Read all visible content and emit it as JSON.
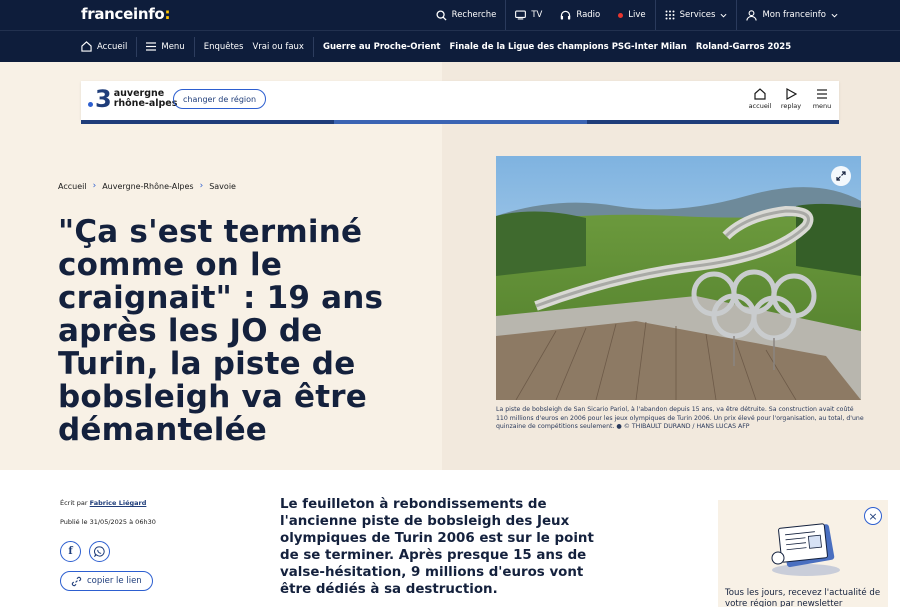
{
  "header": {
    "logo_main": "franceinfo",
    "logo_dot": ":",
    "search_label": "Recherche",
    "tv_label": "TV",
    "radio_label": "Radio",
    "live_label": "Live",
    "services_label": "Services",
    "account_label": "Mon franceinfo"
  },
  "subnav": {
    "home_label": "Accueil",
    "menu_label": "Menu",
    "links": [
      "Enquêtes",
      "Vrai ou faux"
    ],
    "topics": [
      "Guerre au Proche-Orient",
      "Finale de la Ligue des champions PSG-Inter Milan",
      "Roland-Garros 2025"
    ]
  },
  "region": {
    "number": "3",
    "name_line1": "auvergne",
    "name_line2": "rhône-alpes",
    "change_label": "changer de région",
    "nav": [
      {
        "label": "accueil",
        "icon": "home-icon"
      },
      {
        "label": "replay",
        "icon": "play-icon"
      },
      {
        "label": "menu",
        "icon": "hamburger-icon"
      }
    ]
  },
  "breadcrumb": [
    "Accueil",
    "Auvergne-Rhône-Alpes",
    "Savoie"
  ],
  "article": {
    "headline": "\"Ça s'est terminé comme on le craignait\" : 19 ans après les JO de Turin, la piste de bobsleigh va être démantelée",
    "caption": "La piste de bobsleigh de San Sicario Pariol, à l'abandon depuis 15 ans, va être détruite. Sa construction avait coûté 110 millions d'euros en 2006 pour les jeux olympiques de Turin 2006. Un prix élevé pour l'organisation, au total, d'une quinzaine de compétitions seulement. ● © THIBAULT DURAND / HANS LUCAS AFP",
    "author_prefix": "Écrit par",
    "author_name": "Fabrice Liégard",
    "published": "Publié le 31/05/2025 à 06h30",
    "copy_link_label": "copier le lien",
    "chapo": "Le feuilleton à rebondissements de l'ancienne piste de bobsleigh des Jeux olympiques de Turin 2006 est sur le point de se terminer. Après presque 15 ans de valse-hésitation, 9 millions d'euros vont être dédiés à sa destruction."
  },
  "newsletter": {
    "text": "Tous les jours, recevez l'actualité de votre région par newsletter"
  },
  "colors": {
    "navy": "#0e1d3b",
    "accent_blue": "#2d5fd0",
    "live_red": "#e8352e",
    "logo_yellow": "#ffc400",
    "hero_bg": "#f8f1e6"
  }
}
